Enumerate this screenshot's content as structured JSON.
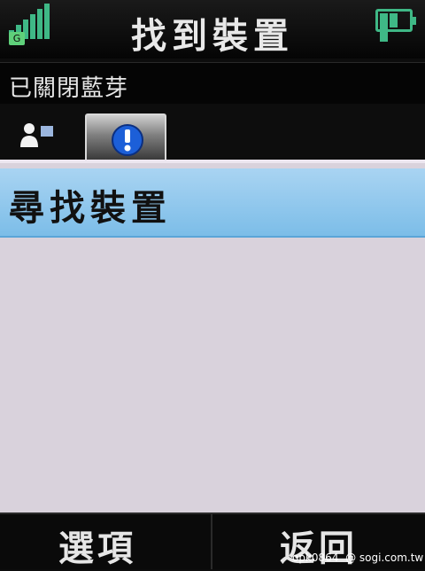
{
  "header": {
    "title": "找到裝置",
    "network_label": "G",
    "signal_icon": "signal-strength-icon",
    "battery_icon": "battery-full-icon"
  },
  "status": {
    "text": "已關閉藍芽"
  },
  "tabs": [
    {
      "icon": "contacts-icon",
      "selected": false
    },
    {
      "icon": "info-icon",
      "selected": true
    }
  ],
  "list": {
    "items": [
      {
        "label": "尋找裝置",
        "selected": true
      }
    ]
  },
  "softkeys": {
    "left": "選項",
    "right": "返回"
  },
  "watermark": {
    "user": "opk0864",
    "site": "@ sogi.com.tw"
  },
  "colors": {
    "accent": "#3fb886",
    "selection": "#8cc6ee",
    "background": "#d9d2dc"
  }
}
